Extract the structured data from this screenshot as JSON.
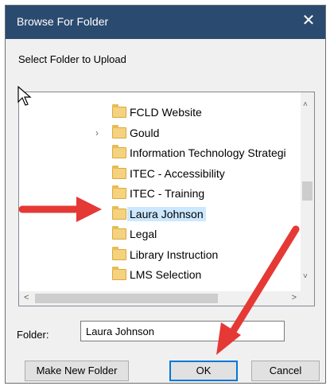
{
  "dialog": {
    "title": "Browse For Folder",
    "close_glyph": "✕",
    "instruction": "Select Folder to Upload"
  },
  "tree": {
    "items": [
      {
        "label": "FCLD Website",
        "has_expander": false,
        "selected": false
      },
      {
        "label": "Gould",
        "has_expander": true,
        "selected": false
      },
      {
        "label": "Information Technology Strategi",
        "has_expander": false,
        "selected": false
      },
      {
        "label": "ITEC - Accessibility",
        "has_expander": false,
        "selected": false
      },
      {
        "label": "ITEC - Training",
        "has_expander": false,
        "selected": false
      },
      {
        "label": "Laura Johnson",
        "has_expander": false,
        "selected": true
      },
      {
        "label": "Legal",
        "has_expander": false,
        "selected": false
      },
      {
        "label": "Library Instruction",
        "has_expander": false,
        "selected": false
      },
      {
        "label": "LMS Selection",
        "has_expander": false,
        "selected": false
      }
    ],
    "expander_glyph": "›",
    "scroll": {
      "up": "˄",
      "down": "˅",
      "left": "<",
      "right": ">"
    }
  },
  "folder": {
    "label": "Folder:",
    "value": "Laura Johnson"
  },
  "buttons": {
    "new_folder": "Make New Folder",
    "ok": "OK",
    "cancel": "Cancel"
  },
  "colors": {
    "titlebar": "#2b4a6f",
    "selection": "#cce8ff",
    "annotation_arrow": "#e53935",
    "folder_icon": "#f5d27f",
    "ok_border": "#0078d7"
  },
  "icons": {
    "folder": "folder-icon",
    "cursor": "mouse-pointer-icon",
    "annotation": "red-arrow-icon"
  }
}
